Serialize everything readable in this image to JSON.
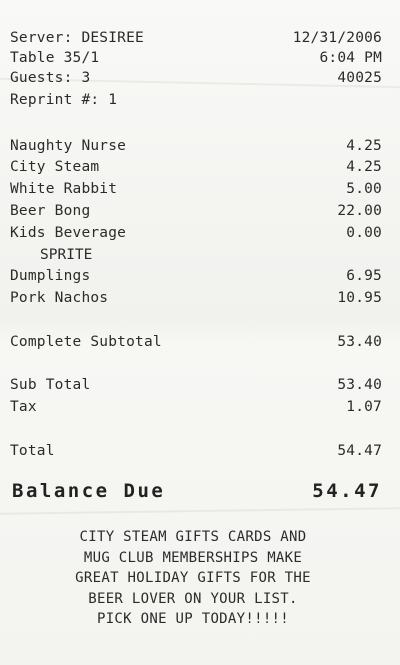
{
  "header": {
    "server": "Server: DESIREE",
    "date": "12/31/2006",
    "table": "Table 35/1",
    "time": "6:04 PM",
    "guests": "Guests: 3",
    "check_number": "40025",
    "reprint": "Reprint #: 1"
  },
  "items": [
    {
      "name": "Naughty Nurse",
      "price": "4.25"
    },
    {
      "name": "City Steam",
      "price": "4.25"
    },
    {
      "name": "White Rabbit",
      "price": "5.00"
    },
    {
      "name": "Beer Bong",
      "price": "22.00"
    },
    {
      "name": "Kids Beverage",
      "price": "0.00"
    },
    {
      "name": "Dumplings",
      "price": "6.95"
    },
    {
      "name": "Pork Nachos",
      "price": "10.95"
    }
  ],
  "modifier": "SPRITE",
  "totals": {
    "complete_subtotal_label": "Complete Subtotal",
    "complete_subtotal": "53.40",
    "sub_total_label": "Sub Total",
    "sub_total": "53.40",
    "tax_label": "Tax",
    "tax": "1.07",
    "total_label": "Total",
    "total": "54.47",
    "balance_due_label": "Balance Due",
    "balance_due": "54.47"
  },
  "promo_lines": [
    "CITY STEAM GIFTS CARDS AND",
    "MUG CLUB MEMBERSHIPS MAKE",
    "GREAT HOLIDAY GIFTS FOR THE",
    "BEER LOVER ON YOUR LIST.",
    "PICK ONE UP TODAY!!!!!"
  ]
}
